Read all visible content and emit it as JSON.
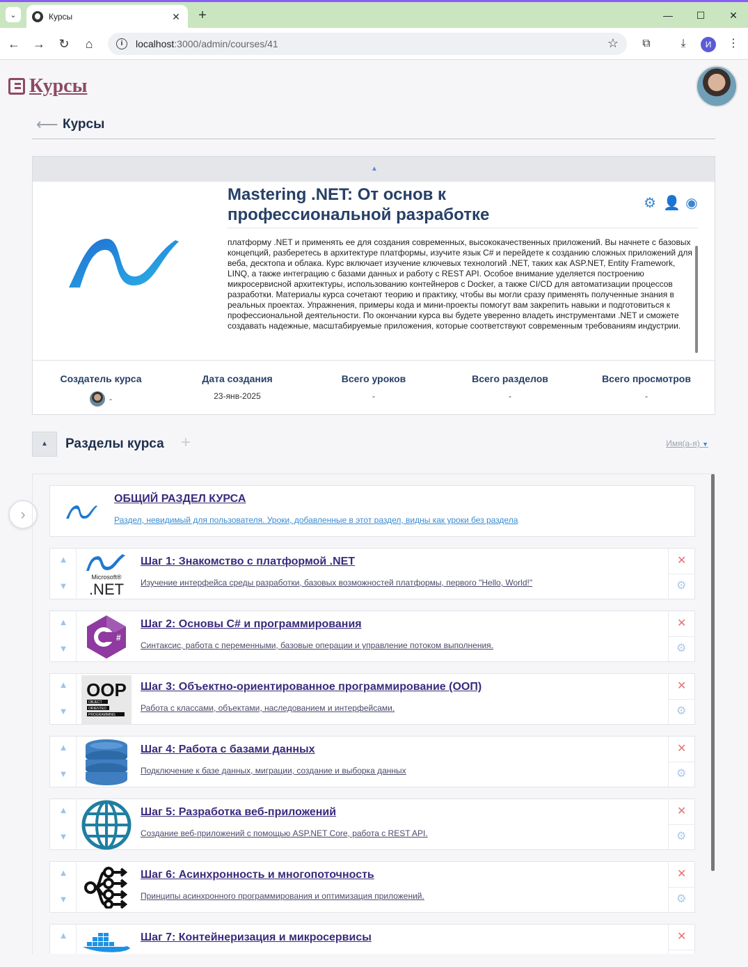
{
  "browser": {
    "tab_title": "Курсы",
    "url_host": "localhost",
    "url_path": ":3000/admin/courses/41",
    "profile_initial": "И"
  },
  "header": {
    "brand": "Курсы",
    "back_title": "Курсы"
  },
  "course": {
    "title": "Mastering .NET: От основ к профессиональной разработке",
    "description": "платформу .NET и применять ее для создания современных, высококачественных приложений. Вы начнете с базовых концепций, разберетесь в архитектуре платформы, изучите язык C# и перейдете к созданию сложных приложений для веба, десктопа и облака. Курс включает изучение ключевых технологий .NET, таких как ASP.NET, Entity Framework, LINQ, а также интеграцию с базами данных и работу с REST API. Особое внимание уделяется построению микросервисной архитектуры, использованию контейнеров с Docker, а также CI/CD для автоматизации процессов разработки. Материалы курса сочетают теорию и практику, чтобы вы могли сразу применять полученные знания в реальных проектах. Упражнения, примеры кода и мини-проекты помогут вам закрепить навыки и подготовиться к профессиональной деятельности. По окончании курса вы будете уверенно владеть инструментами .NET и сможете создавать надежные, масштабируемые приложения, которые соответствуют современным требованиям индустрии.",
    "stats": [
      {
        "label": "Создатель курса",
        "value": "-"
      },
      {
        "label": "Дата создания",
        "value": "23-янв-2025"
      },
      {
        "label": "Всего уроков",
        "value": "-"
      },
      {
        "label": "Всего разделов",
        "value": "-"
      },
      {
        "label": "Всего просмотров",
        "value": "-"
      }
    ]
  },
  "sections": {
    "title": "Разделы курса",
    "sort_label": "Имя(а-я)",
    "general": {
      "title": "ОБЩИЙ РАЗДЕЛ КУРСА",
      "description": "Раздел, невидимый для пользователя. Уроки, добавленные в этот раздел, видны как уроки без раздела"
    },
    "steps": [
      {
        "title": "Шаг 1: Знакомство с платформой .NET",
        "description": "Изучение интерфейса среды разработки, базовых возможностей платформы, первого \"Hello, World!\"",
        "icon": "dotnet-icon"
      },
      {
        "title": "Шаг 2: Основы C# и программирования",
        "description": "Синтаксис, работа с переменными, базовые операции и управление потоком выполнения.",
        "icon": "csharp-icon"
      },
      {
        "title": "Шаг 3: Объектно-ориентированное программирование (ООП)",
        "description": "Работа с классами, объектами, наследованием и интерфейсами.",
        "icon": "oop-icon"
      },
      {
        "title": "Шаг 4: Работа с базами данных",
        "description": "Подключение к базе данных, миграции, создание и выборка данных",
        "icon": "database-icon"
      },
      {
        "title": "Шаг 5: Разработка веб-приложений",
        "description": "Создание веб-приложений с помощью ASP.NET Core, работа с REST API.",
        "icon": "globe-icon"
      },
      {
        "title": "Шаг 6: Асинхронность и многопоточность",
        "description": "Принципы асинхронного программирования и оптимизация приложений.",
        "icon": "async-icon"
      },
      {
        "title": "Шаг 7: Контейнеризация и микросервисы",
        "description": "",
        "icon": "docker-icon"
      }
    ]
  }
}
